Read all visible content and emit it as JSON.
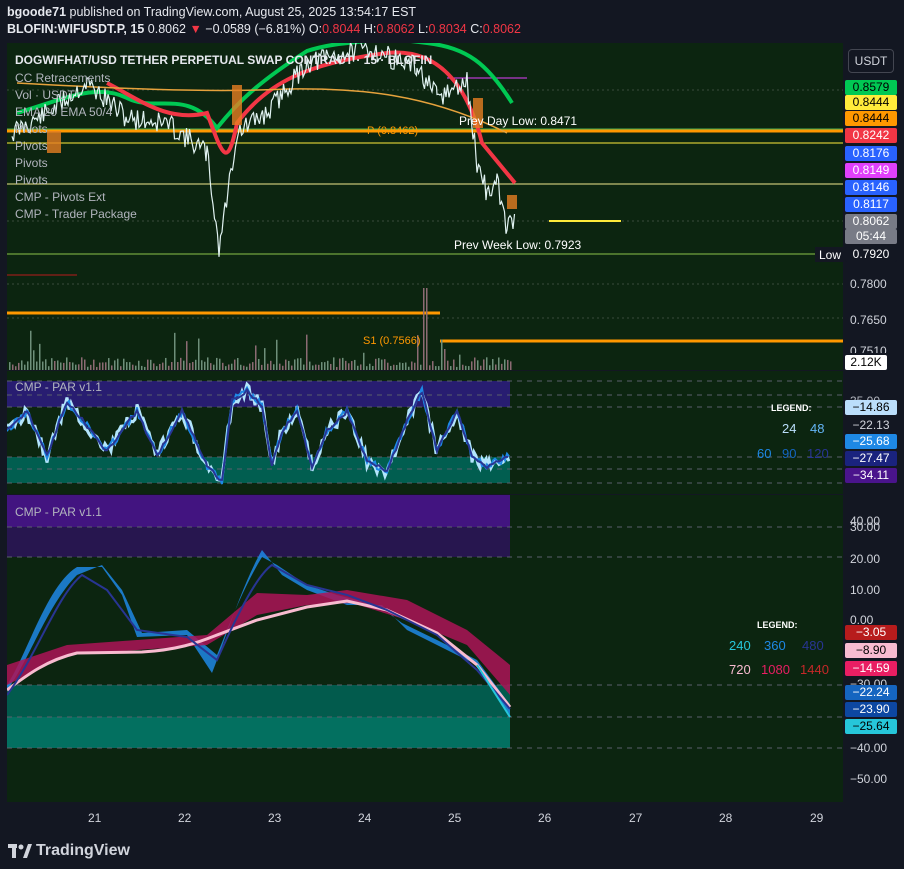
{
  "header": {
    "user": "bgoode71",
    "published_text": "published on TradingView.com, August 25, 2025 13:54:17 EST",
    "symbol": "BLOFIN:WIFUSDT.P, 15",
    "price": "0.8062",
    "change": "−0.0589 (−6.81%)",
    "o_label": "O:",
    "o_value": "0.8044",
    "h_label": "H:",
    "h_value": "0.8062",
    "l_label": "L:",
    "l_value": "0.8034",
    "c_label": "C:",
    "c_value": "0.8062"
  },
  "main_panel": {
    "title": "DOGWIFHAT/USD TETHER PERPETUAL SWAP CONTRACT · 15 · BLOFIN",
    "indicators": [
      "CC Retracements",
      "Vol · USDT",
      "EMA 20 EMA 50/4",
      "Pivots",
      "Pivots",
      "Pivots",
      "Pivots",
      "CMP - Pivots Ext",
      "CMP - Trader Package"
    ],
    "currency_button": "USDT",
    "annotations": {
      "prev_day_low": "Prev Day Low: 0.8471",
      "pivot_p": "P (0.8462)",
      "prev_week_low": "Prev Week Low: 0.7923",
      "s1": "S1 (0.7566)",
      "low_tag": "Low"
    },
    "price_labels": [
      {
        "text": "0.8579",
        "bg": "#00c853",
        "fg": "#000000"
      },
      {
        "text": "0.8444",
        "bg": "#ffeb3b",
        "fg": "#000000"
      },
      {
        "text": "0.8444",
        "bg": "#ff9800",
        "fg": "#000000"
      },
      {
        "text": "0.8242",
        "bg": "#f23645",
        "fg": "#ffffff"
      },
      {
        "text": "0.8176",
        "bg": "#2962ff",
        "fg": "#ffffff"
      },
      {
        "text": "0.8149",
        "bg": "#e040fb",
        "fg": "#ffffff"
      },
      {
        "text": "0.8146",
        "bg": "#2962ff",
        "fg": "#ffffff"
      },
      {
        "text": "0.8117",
        "bg": "#2962ff",
        "fg": "#ffffff"
      },
      {
        "text": "0.8062",
        "bg": "#787b86",
        "fg": "#ffffff"
      },
      {
        "text": "05:44",
        "bg": "#787b86",
        "fg": "#ffffff"
      },
      {
        "text": "0.7920",
        "bg": "#131722",
        "fg": "#ffffff"
      }
    ],
    "axis_ticks": [
      "0.7800",
      "0.7650",
      "0.7510"
    ],
    "volume_label": "2.12K"
  },
  "par1": {
    "title": "CMP - PAR v1.1",
    "legend_title": "LEGEND:",
    "legend_row1": [
      "24",
      "48"
    ],
    "legend_row2": [
      "60",
      "90",
      "120"
    ],
    "values": [
      {
        "text": "−14.86",
        "bg": "#bbdefb",
        "fg": "#000000"
      },
      {
        "text": "−22.13",
        "bg": "#131722",
        "fg": "#d1d4dc"
      },
      {
        "text": "−25.68",
        "bg": "#1e88e5",
        "fg": "#ffffff"
      },
      {
        "text": "−27.47",
        "bg": "#1a237e",
        "fg": "#ffffff"
      },
      {
        "text": "−34.11",
        "bg": "#4a148c",
        "fg": "#ffffff"
      }
    ],
    "top_tick": "35.00"
  },
  "par2": {
    "title": "CMP - PAR v1.1",
    "legend_title": "LEGEND:",
    "legend_row1": [
      "240",
      "360",
      "480"
    ],
    "legend_row2": [
      "720",
      "1080",
      "1440"
    ],
    "axis_ticks": [
      "40.00",
      "30.00",
      "20.00",
      "10.00",
      "0.00",
      "−30.00",
      "−40.00",
      "−50.00"
    ],
    "values": [
      {
        "text": "−3.05",
        "bg": "#b71c1c",
        "fg": "#ffffff"
      },
      {
        "text": "−8.90",
        "bg": "#f8bbd0",
        "fg": "#000000"
      },
      {
        "text": "−14.59",
        "bg": "#e91e63",
        "fg": "#ffffff"
      },
      {
        "text": "−22.24",
        "bg": "#1565c0",
        "fg": "#ffffff"
      },
      {
        "text": "−23.90",
        "bg": "#0d47a1",
        "fg": "#ffffff"
      },
      {
        "text": "−25.64",
        "bg": "#26c6da",
        "fg": "#000000"
      }
    ]
  },
  "chart_data": {
    "type": "line",
    "title": "DOGWIFHAT/USD TETHER PERPETUAL SWAP CONTRACT · 15 · BLOFIN",
    "x": [
      "21",
      "22",
      "23",
      "24",
      "25",
      "26",
      "27",
      "28",
      "29"
    ],
    "series": [
      {
        "name": "price",
        "values": [
          0.852,
          0.843,
          0.857,
          0.86,
          0.85,
          0.8062
        ]
      }
    ],
    "ylim": [
      0.751,
      0.8579
    ],
    "levels": {
      "prev_day_low": 0.8471,
      "pivot_p": 0.8462,
      "prev_week_low": 0.7923,
      "s1": 0.7566,
      "low": 0.792
    }
  },
  "footer": {
    "brand": "TradingView"
  },
  "colors": {
    "bg": "#131722",
    "panel_bg": "#0c2510",
    "up": "#00c853",
    "down": "#f23645"
  }
}
